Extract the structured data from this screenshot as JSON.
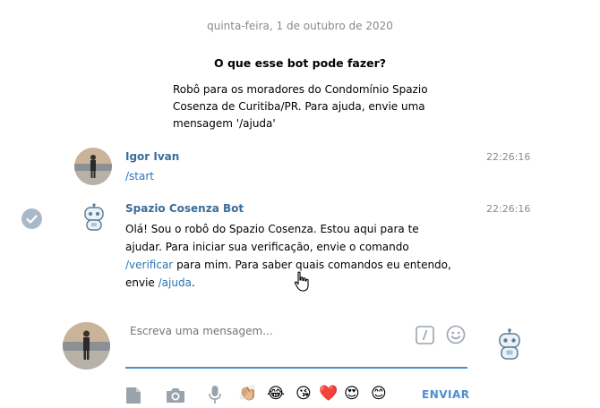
{
  "chat": {
    "date": "quinta-feira, 1 de outubro de 2020",
    "bot_info": {
      "title": "O que esse bot pode fazer?",
      "description": "Robô para os moradores do Condomínio Spazio Cosenza de Curitiba/PR. Para ajuda, envie uma mensagem '/ajuda'"
    },
    "messages": [
      {
        "author": "Igor Ivan",
        "time": "22:26:16",
        "text": "/start"
      },
      {
        "author": "Spazio Cosenza Bot",
        "time": "22:26:16",
        "text_part1": "Olá! Sou o robô do Spazio Cosenza. Estou aqui para te ajudar. Para iniciar sua verificação, envie o comando ",
        "link1": "/verificar",
        "text_part2": " para mim. Para saber quais comandos eu entendo, envie ",
        "link2": "/ajuda",
        "text_part3": "."
      }
    ]
  },
  "composer": {
    "placeholder": "Escreva uma mensagem...",
    "send_label": "ENVIAR",
    "emojis": [
      "👏🏼",
      "😂",
      "😘",
      "❤️",
      "😍",
      "😊"
    ]
  },
  "colors": {
    "accent": "#4a8fd0",
    "author": "#3a6d99",
    "link": "#2a73b5"
  }
}
